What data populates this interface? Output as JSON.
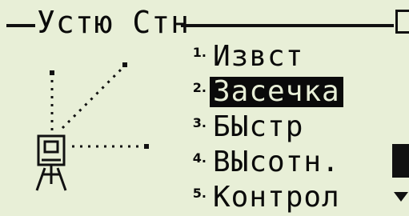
{
  "header": {
    "title": "Устю Стн"
  },
  "menu": {
    "items": [
      {
        "number": "1.",
        "label": "Извст",
        "selected": false
      },
      {
        "number": "2.",
        "label": "Засечка",
        "selected": true
      },
      {
        "number": "3.",
        "label": "БЫстр",
        "selected": false
      },
      {
        "number": "4.",
        "label": "ВЫсотн.",
        "selected": false
      },
      {
        "number": "5.",
        "label": "Контрол",
        "selected": false
      }
    ]
  },
  "indicators": {
    "scroll_down_icon": "scroll-down-icon",
    "lock_icon": "lock-icon"
  },
  "colors": {
    "background": "#e8efd7",
    "foreground": "#0a0a0a"
  }
}
